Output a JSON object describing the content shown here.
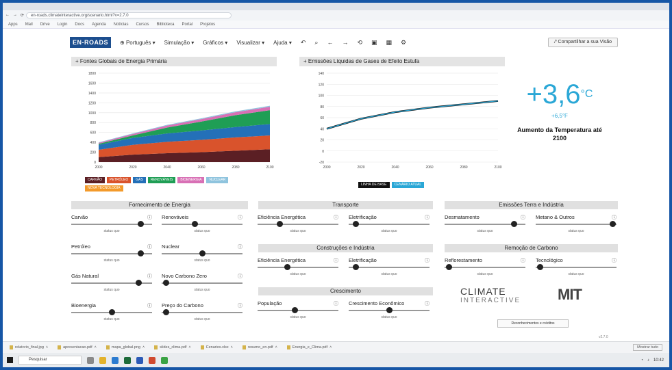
{
  "browser": {
    "url": "en-roads.climateinteractive.org/scenario.html?v=2.7.0",
    "bookmarks": [
      "Apps",
      "Mail",
      "Drive",
      "Login",
      "Docs",
      "Agenda",
      "Notícias",
      "Cursos",
      "Biblioteca",
      "Portal",
      "Projetos"
    ]
  },
  "toolbar": {
    "logo": "EN-ROADS",
    "menus": [
      "Português",
      "Simulação",
      "Gráficos",
      "Visualizar",
      "Ajuda"
    ],
    "share": "Compartilhar a sua Visão"
  },
  "chart1": {
    "title": "Fontes Globais de Energia Primária",
    "legend": [
      {
        "label": "CARVÃO",
        "color": "#5b1f24"
      },
      {
        "label": "PETRÓLEO",
        "color": "#d9532c"
      },
      {
        "label": "GÁS",
        "color": "#2470b8"
      },
      {
        "label": "RENOVÁVEIS",
        "color": "#1f9e55"
      },
      {
        "label": "BIOENERGIA",
        "color": "#d870b5"
      },
      {
        "label": "NUCLEAR",
        "color": "#8fc4de"
      },
      {
        "label": "NOVA TECNOLOGIA",
        "color": "#f39a2b"
      }
    ]
  },
  "chart2": {
    "title": "Emissões Líquidas de Gases de Efeito Estufa",
    "legend": [
      {
        "label": "LINHA DE BASE",
        "color": "#111111"
      },
      {
        "label": "CENÁRIO ATUAL",
        "color": "#2aa7d6"
      }
    ]
  },
  "chart_data": [
    {
      "type": "area",
      "title": "Fontes Globais de Energia Primária",
      "x": [
        2000,
        2020,
        2040,
        2060,
        2080,
        2100
      ],
      "xlim": [
        2000,
        2100
      ],
      "ylim": [
        0,
        1800
      ],
      "yticks": [
        0,
        200,
        400,
        600,
        800,
        1000,
        1200,
        1400,
        1600,
        1800
      ],
      "series": [
        {
          "name": "CARVÃO",
          "values": [
            100,
            150,
            180,
            200,
            230,
            260
          ]
        },
        {
          "name": "PETRÓLEO",
          "values": [
            150,
            200,
            230,
            250,
            270,
            280
          ]
        },
        {
          "name": "GÁS",
          "values": [
            100,
            140,
            170,
            190,
            210,
            230
          ]
        },
        {
          "name": "RENOVÁVEIS",
          "values": [
            20,
            50,
            120,
            180,
            240,
            280
          ]
        },
        {
          "name": "BIOENERGIA",
          "values": [
            20,
            30,
            40,
            50,
            60,
            70
          ]
        },
        {
          "name": "NUCLEAR",
          "values": [
            10,
            12,
            14,
            16,
            18,
            20
          ]
        }
      ]
    },
    {
      "type": "line",
      "title": "Emissões Líquidas de Gases de Efeito Estufa",
      "x": [
        2000,
        2020,
        2040,
        2060,
        2080,
        2100
      ],
      "xlim": [
        2000,
        2100
      ],
      "ylim": [
        -20,
        140
      ],
      "yticks": [
        -20,
        0,
        20,
        40,
        60,
        80,
        100,
        120,
        140
      ],
      "series": [
        {
          "name": "LINHA DE BASE",
          "values": [
            40,
            58,
            70,
            78,
            84,
            90
          ]
        },
        {
          "name": "CENÁRIO ATUAL",
          "values": [
            40,
            58,
            70,
            78,
            84,
            90
          ]
        }
      ]
    }
  ],
  "temperature": {
    "value": "+3,6",
    "unit": "°C",
    "sub": "+6,5°F",
    "label": "Aumento da Temperatura até 2100"
  },
  "sections": {
    "energy": "Fornecimento de Energia",
    "transport": "Transporte",
    "buildings": "Construções e Indústria",
    "growth": "Crescimento",
    "land": "Emissões Terra e Indústria",
    "removal": "Remoção de Carbono"
  },
  "sliders": [
    {
      "label": "Carvão",
      "hint": "status quo",
      "value": 0.88
    },
    {
      "label": "Renováveis",
      "hint": "status quo",
      "value": 0.4
    },
    {
      "label": "Petróleo",
      "hint": "status quo",
      "value": 0.88
    },
    {
      "label": "Nuclear",
      "hint": "status quo",
      "value": 0.5
    },
    {
      "label": "Gás Natural",
      "hint": "status quo",
      "value": 0.85
    },
    {
      "label": "Novo Carbono Zero",
      "hint": "status quo",
      "value": 0.02
    },
    {
      "label": "Bioenergia",
      "hint": "status quo",
      "value": 0.5
    },
    {
      "label": "Preço do Carbono",
      "hint": "status quo",
      "value": 0.02
    },
    {
      "label": "Eficiência Energética",
      "hint": "status quo",
      "value": 0.25
    },
    {
      "label": "Eletrificação",
      "hint": "status quo",
      "value": 0.05
    },
    {
      "label": "Eficiência Energética",
      "hint": "status quo",
      "value": 0.35
    },
    {
      "label": "Eletrificação",
      "hint": "status quo",
      "value": 0.05
    },
    {
      "label": "População",
      "hint": "status quo",
      "value": 0.45
    },
    {
      "label": "Crescimento Econômico",
      "hint": "status quo",
      "value": 0.5
    },
    {
      "label": "Desmatamento",
      "hint": "status quo",
      "value": 0.88
    },
    {
      "label": "Metano & Outros",
      "hint": "status quo",
      "value": 0.98
    },
    {
      "label": "Reflorestamento",
      "hint": "status quo",
      "value": 0.02
    },
    {
      "label": "Tecnológico",
      "hint": "status quo",
      "value": 0.02
    }
  ],
  "footer": {
    "climate_interactive": "CLIMATE",
    "climate_interactive_sub": "INTERACTIVE",
    "mit": "MIT",
    "ack": "Reconhecimentos e créditos",
    "version": "v2.7.0"
  },
  "downloads": [
    "relatorio_final.jpg",
    "apresentacao.pdf",
    "mapa_global.png",
    "slides_clima.pdf",
    "Cenarios.xlsx",
    "resumo_en.pdf",
    "Energia_e_Clima.pdf"
  ],
  "downloads_show_all": "Mostrar tudo",
  "taskbar": {
    "search": "Pesquisar",
    "clock": "10:42"
  }
}
